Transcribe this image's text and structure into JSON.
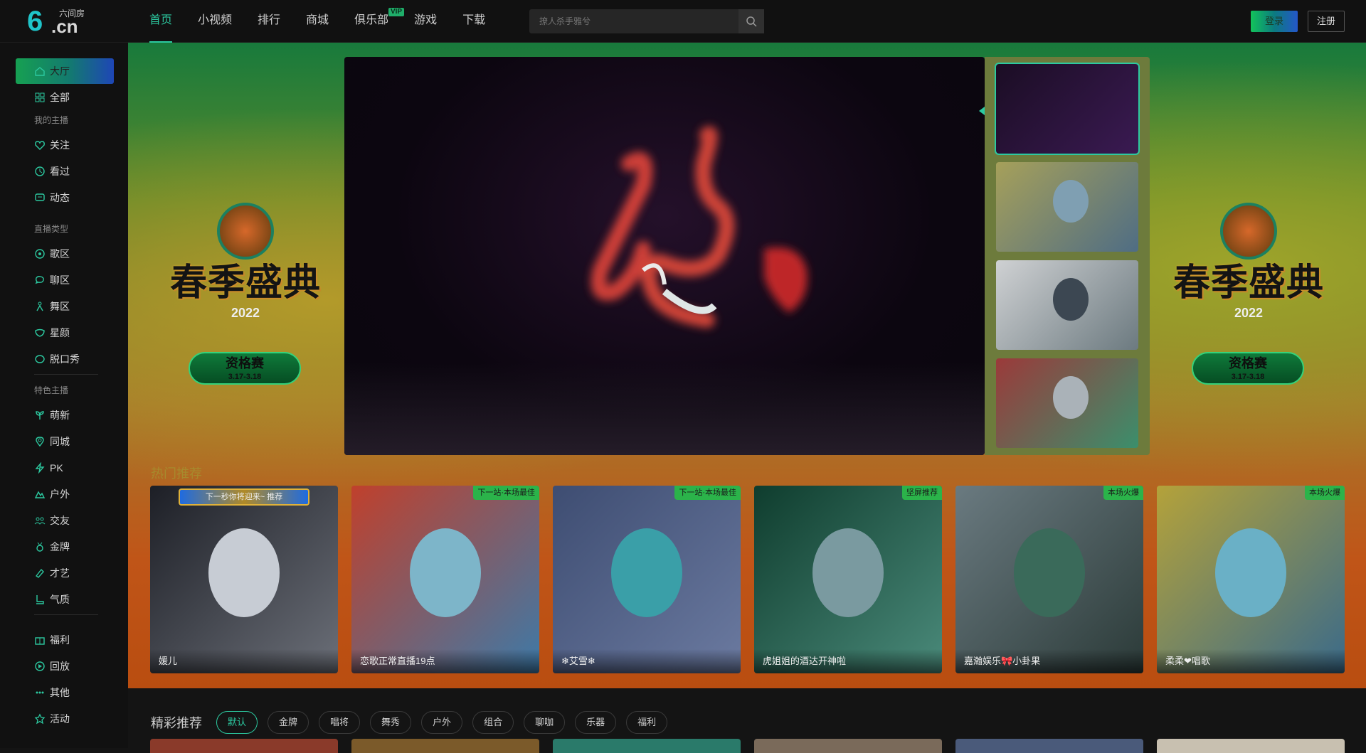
{
  "header": {
    "logo_number": "6",
    "logo_suffix": ".cn",
    "logo_text": "六间房",
    "nav": [
      {
        "label": "首页",
        "active": true
      },
      {
        "label": "小视频"
      },
      {
        "label": "排行"
      },
      {
        "label": "商城"
      },
      {
        "label": "俱乐部",
        "badge": "VIP"
      },
      {
        "label": "游戏"
      },
      {
        "label": "下载"
      }
    ],
    "search_placeholder": "撩人杀手雅兮",
    "login_label": "登录",
    "register_label": "注册"
  },
  "sidebar": {
    "top_items": [
      {
        "label": "大厅",
        "icon": "home-icon",
        "active": true
      },
      {
        "label": "全部",
        "icon": "grid-icon"
      }
    ],
    "sections": [
      {
        "title": "我的主播",
        "items": [
          {
            "label": "关注",
            "icon": "heart-icon"
          },
          {
            "label": "看过",
            "icon": "clock-icon"
          },
          {
            "label": "动态",
            "icon": "chat-icon"
          }
        ]
      },
      {
        "title": "直播类型",
        "items": [
          {
            "label": "歌区",
            "icon": "music-icon"
          },
          {
            "label": "聊区",
            "icon": "bubble-icon"
          },
          {
            "label": "舞区",
            "icon": "dance-icon"
          },
          {
            "label": "星颜",
            "icon": "mask-icon"
          },
          {
            "label": "脱口秀",
            "icon": "mic-icon"
          }
        ]
      },
      {
        "title": "特色主播",
        "items": [
          {
            "label": "萌新",
            "icon": "sprout-icon"
          },
          {
            "label": "同城",
            "icon": "location-icon"
          },
          {
            "label": "PK",
            "icon": "lightning-icon"
          },
          {
            "label": "户外",
            "icon": "mountain-icon"
          },
          {
            "label": "交友",
            "icon": "people-icon"
          },
          {
            "label": "金牌",
            "icon": "medal-icon"
          },
          {
            "label": "才艺",
            "icon": "palette-icon"
          },
          {
            "label": "气质",
            "icon": "boot-icon"
          }
        ]
      }
    ],
    "bottom_items": [
      {
        "label": "福利",
        "icon": "gift-icon"
      },
      {
        "label": "回放",
        "icon": "replay-icon"
      },
      {
        "label": "其他",
        "icon": "dots-icon"
      },
      {
        "label": "活动",
        "icon": "star-icon"
      }
    ]
  },
  "hero": {
    "festival_title": "春季盛典",
    "festival_year": "2022",
    "festival_badge_title": "资格赛",
    "festival_badge_dates": "3.17-3.18"
  },
  "hot": {
    "heading": "热门推荐",
    "cards": [
      {
        "name": "媛儿",
        "banner": "下一秒你将迎来~ 推荐",
        "tag": ""
      },
      {
        "name": "恋歌正常直播19点",
        "tag": "下一站·本场最佳"
      },
      {
        "name": "❄艾雪❄",
        "tag": "下一站·本场最佳"
      },
      {
        "name": "虎姐姐的酒达开神啦",
        "tag": "坚屏推荐"
      },
      {
        "name": "嘉瀚娱乐🎀小卦果",
        "tag": "本场火爆"
      },
      {
        "name": "柔柔❤唱歌",
        "tag": "本场火爆"
      }
    ]
  },
  "featured": {
    "heading": "精彩推荐",
    "filters": [
      "默认",
      "金牌",
      "唱将",
      "舞秀",
      "户外",
      "组合",
      "聊咖",
      "乐器",
      "福利"
    ],
    "active_filter": "默认"
  },
  "colors": {
    "accent": "#2cc9a0",
    "sidebar_bg": "#111111",
    "hot_tag": "#2bb34a"
  }
}
